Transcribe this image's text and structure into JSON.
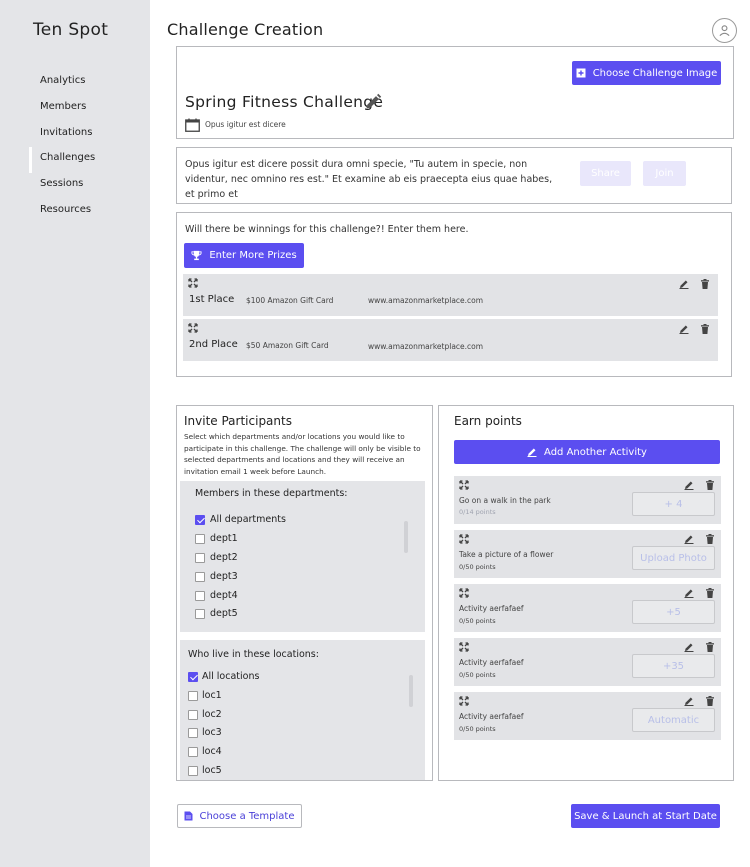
{
  "sidebar": {
    "brand": "Ten Spot",
    "items": [
      {
        "label": "Analytics"
      },
      {
        "label": "Members"
      },
      {
        "label": "Invitations"
      },
      {
        "label": "Challenges"
      },
      {
        "label": "Sessions"
      },
      {
        "label": "Resources"
      }
    ],
    "active": "Challenges"
  },
  "header": {
    "title": "Challenge Creation"
  },
  "challenge": {
    "image_button": "Choose Challenge Image",
    "name": "Spring Fitness Challenge",
    "date": "Opus igitur est dicere",
    "description": "Opus igitur est dicere possit dura omni specie, \"Tu autem in specie, non videntur, nec omnino res est.\" Et examine ab eis praecepta eius quae habes, et primo et",
    "share_button": "Share",
    "join_button": "Join"
  },
  "prizes": {
    "question": "Will there be winnings for this challenge?! Enter them here.",
    "add_button": "Enter More Prizes",
    "rows": [
      {
        "place": "1st Place",
        "prize": "$100 Amazon Gift Card",
        "url": "www.amazonmarketplace.com"
      },
      {
        "place": "2nd Place",
        "prize": "$50 Amazon Gift Card",
        "url": "www.amazonmarketplace.com"
      }
    ]
  },
  "invite": {
    "title": "Invite Participants",
    "description": "Select which departments and/or locations you would like to participate in this challenge. The challenge will only be visible to selected departments and locations and they will receive an invitation email 1 week before Launch.",
    "departments_header": "Members in these departments:",
    "departments": [
      {
        "label": "All departments",
        "checked": true
      },
      {
        "label": "dept1",
        "checked": false
      },
      {
        "label": "dept2",
        "checked": false
      },
      {
        "label": "dept3",
        "checked": false
      },
      {
        "label": "dept4",
        "checked": false
      },
      {
        "label": "dept5",
        "checked": false
      }
    ],
    "locations_header": "Who live in these locations:",
    "locations": [
      {
        "label": "All locations",
        "checked": true
      },
      {
        "label": "loc1",
        "checked": false
      },
      {
        "label": "loc2",
        "checked": false
      },
      {
        "label": "loc3",
        "checked": false
      },
      {
        "label": "loc4",
        "checked": false
      },
      {
        "label": "loc5",
        "checked": false
      }
    ]
  },
  "earn": {
    "title": "Earn points",
    "add_button": "Add Another Activity",
    "activities": [
      {
        "name": "Go on a walk in the park",
        "points": "0/14 points",
        "action": "+ 4"
      },
      {
        "name": "Take a picture of a flower",
        "points": "0/50 points",
        "action": "Upload Photo"
      },
      {
        "name": "Activity aerfafaef",
        "points": "0/50 points",
        "action": "+5"
      },
      {
        "name": "Activity aerfafaef",
        "points": "0/50 points",
        "action": "+35"
      },
      {
        "name": "Activity aerfafaef",
        "points": "0/50 points",
        "action": "Automatic"
      }
    ]
  },
  "footer": {
    "template_button": "Choose a Template",
    "launch_button": "Save & Launch at Start Date"
  },
  "colors": {
    "accent": "#5b4ef0",
    "sidebar": "#e4e5e8",
    "row": "#e2e3e6"
  }
}
